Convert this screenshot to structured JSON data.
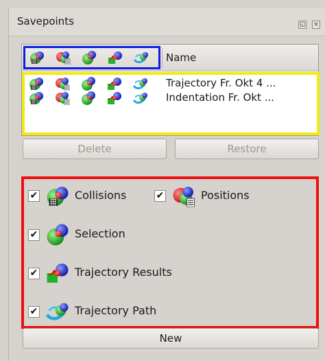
{
  "panel": {
    "title": "Savepoints",
    "float_icon": "float-icon",
    "close_icon": "close-icon"
  },
  "list": {
    "header_icons": [
      "collisions-icon",
      "positions-icon",
      "selection-icon",
      "trajectory-results-icon",
      "trajectory-path-icon"
    ],
    "name_header": "Name",
    "rows": [
      {
        "name": "Trajectory Fr. Okt 4 ..."
      },
      {
        "name": "Indentation Fr. Okt ..."
      }
    ]
  },
  "buttons": {
    "delete": "Delete",
    "restore": "Restore",
    "new": "New"
  },
  "options": [
    {
      "label": "Collisions",
      "checked": true,
      "icon": "collisions-icon"
    },
    {
      "label": "Positions",
      "checked": true,
      "icon": "positions-icon"
    },
    {
      "label": "Selection",
      "checked": true,
      "icon": "selection-icon"
    },
    {
      "label": "Trajectory Results",
      "checked": true,
      "icon": "trajectory-results-icon"
    },
    {
      "label": "Trajectory Path",
      "checked": true,
      "icon": "trajectory-path-icon"
    }
  ],
  "check_glyph": "✔",
  "colors": {
    "highlight_blue": "#0a1de0",
    "highlight_yellow": "#f2ea12",
    "highlight_red": "#ec1010"
  }
}
